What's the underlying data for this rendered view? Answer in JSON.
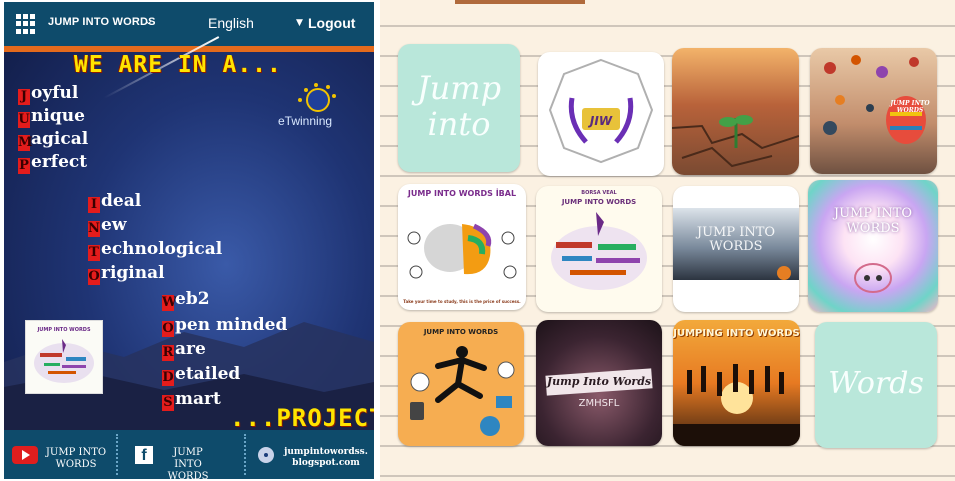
{
  "header": {
    "brand": "JUMP INTO WORDS",
    "language": "English",
    "logout": "Logout"
  },
  "poster": {
    "headline": "WE ARE IN A...",
    "etwinning": "eTwinning",
    "project": "...PROJECT",
    "words": [
      {
        "cap": "J",
        "rest": "oyful"
      },
      {
        "cap": "U",
        "rest": "nique"
      },
      {
        "cap": "M",
        "rest": "agical"
      },
      {
        "cap": "P",
        "rest": "erfect"
      },
      {
        "cap": "I",
        "rest": "deal"
      },
      {
        "cap": "N",
        "rest": "ew"
      },
      {
        "cap": "T",
        "rest": "echnological"
      },
      {
        "cap": "O",
        "rest": "riginal"
      },
      {
        "cap": "W",
        "rest": "eb2"
      },
      {
        "cap": "O",
        "rest": "pen minded"
      },
      {
        "cap": "R",
        "rest": "are"
      },
      {
        "cap": "D",
        "rest": "etailed"
      },
      {
        "cap": "S",
        "rest": "mart"
      }
    ],
    "thumb_title": "JUMP INTO WORDS"
  },
  "footer": {
    "youtube": "JUMP INTO WORDS",
    "facebook": "JUMP INTO WORDS",
    "blog_line1": "jumpintowordss.",
    "blog_line2": "blogspot.com"
  },
  "gallery": {
    "tiles": [
      {
        "id": "jump-into",
        "text": "Jump into"
      },
      {
        "id": "jiw-logo",
        "text": "JIW"
      },
      {
        "id": "cracked-earth",
        "text": ""
      },
      {
        "id": "balloons",
        "text": "JUMP INTO WORDS"
      },
      {
        "id": "brain",
        "text": "JUMP INTO WORDS İBAL",
        "sub": "Take your time to study, this is the price of success."
      },
      {
        "id": "wordcloud",
        "text": "JUMP INTO WORDS",
        "sub": "BORSA VEAL"
      },
      {
        "id": "landscape",
        "text": "JUMP INTO WORDS"
      },
      {
        "id": "colorsplash",
        "text": "JUMP INTO WORDS"
      },
      {
        "id": "jumper-orange",
        "text": "JUMP INTO WORDS"
      },
      {
        "id": "dark-cloud",
        "text": "Jump Into Words",
        "sub": "ZMHSFL"
      },
      {
        "id": "sunset",
        "text": "JUMPING INTO WORDS"
      },
      {
        "id": "words",
        "text": "Words"
      }
    ]
  },
  "colors": {
    "header_bg": "#0e4b6b",
    "accent_orange": "#e46a1c",
    "yellow": "#ffe400",
    "cap_red": "#e41c1c",
    "mint": "#b9e7da",
    "paper": "#fbf1e2"
  }
}
